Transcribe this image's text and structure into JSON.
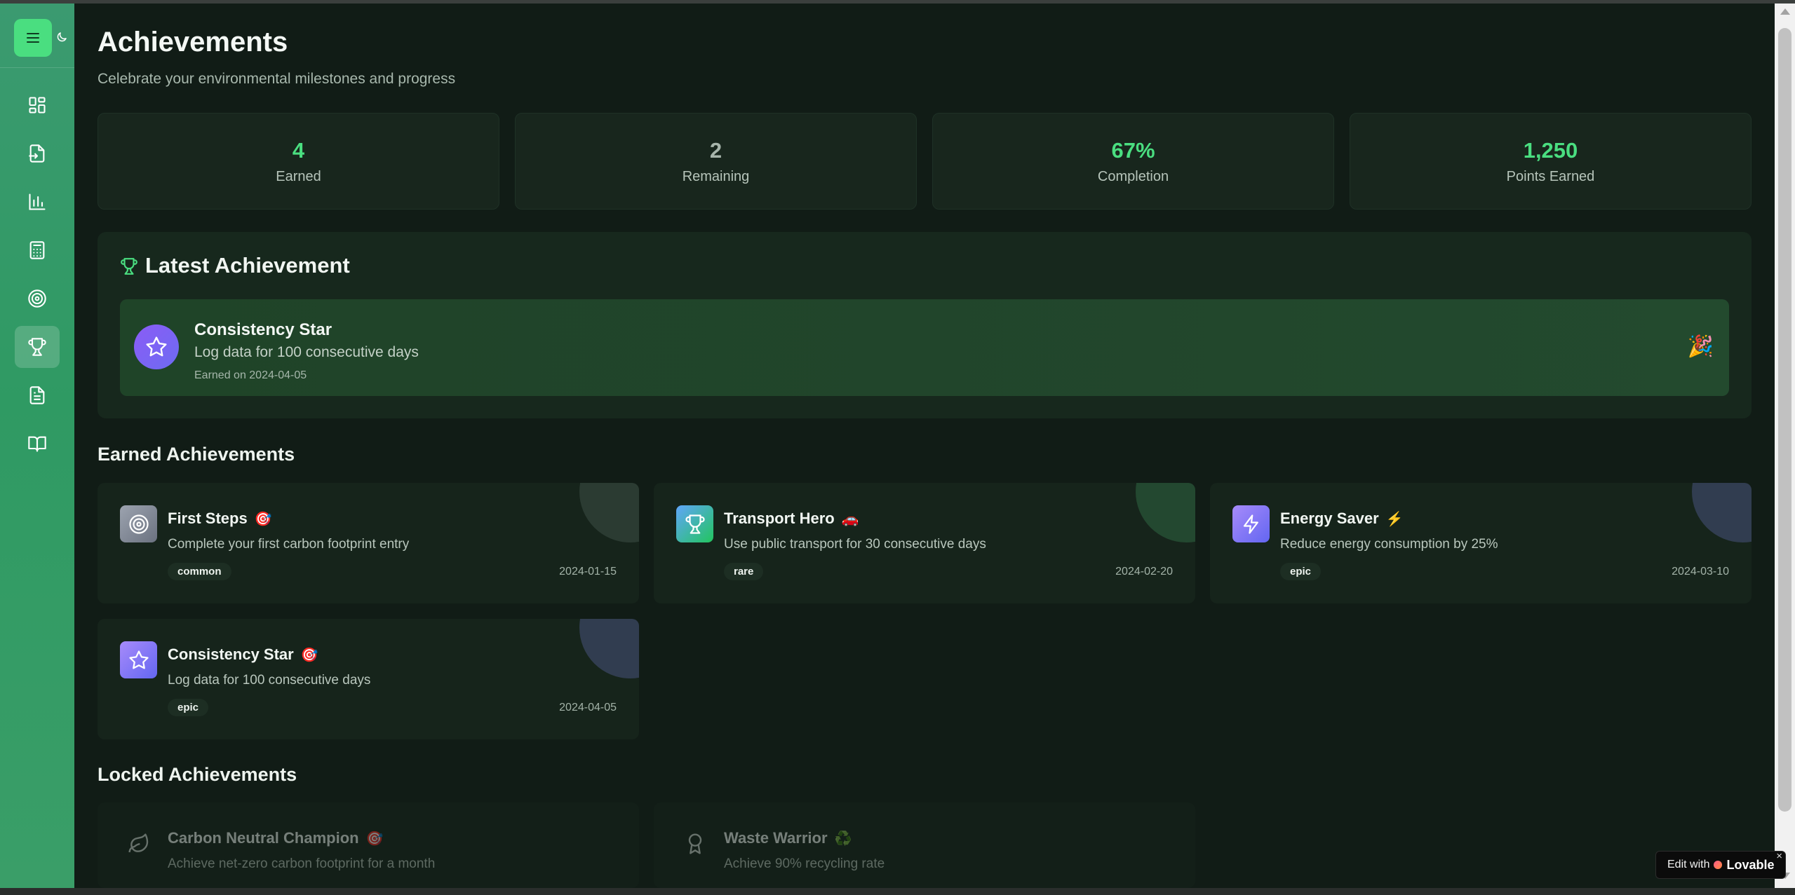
{
  "page": {
    "title": "Achievements",
    "subtitle": "Celebrate your environmental milestones and progress"
  },
  "stats": [
    {
      "value": "4",
      "label": "Earned",
      "color": "#4ade80"
    },
    {
      "value": "2",
      "label": "Remaining",
      "color": "#a7b5ab"
    },
    {
      "value": "67%",
      "label": "Completion",
      "color": "#4ade80"
    },
    {
      "value": "1,250",
      "label": "Points Earned",
      "color": "#4ade80"
    }
  ],
  "latest": {
    "heading": "Latest Achievement",
    "name": "Consistency Star",
    "description": "Log data for 100 consecutive days",
    "earned": "Earned on 2024-04-05",
    "emoji": "🎉"
  },
  "earned_section": {
    "title": "Earned Achievements",
    "items": [
      {
        "name": "First Steps",
        "emoji": "🎯",
        "description": "Complete your first carbon footprint entry",
        "tag": "common",
        "date": "2024-01-15",
        "icon": "target-icon"
      },
      {
        "name": "Transport Hero",
        "emoji": "🚗",
        "description": "Use public transport for 30 consecutive days",
        "tag": "rare",
        "date": "2024-02-20",
        "icon": "trophy-icon"
      },
      {
        "name": "Energy Saver",
        "emoji": "⚡",
        "description": "Reduce energy consumption by 25%",
        "tag": "epic",
        "date": "2024-03-10",
        "icon": "lightning-icon"
      },
      {
        "name": "Consistency Star",
        "emoji": "🎯",
        "description": "Log data for 100 consecutive days",
        "tag": "epic",
        "date": "2024-04-05",
        "icon": "star-icon"
      }
    ]
  },
  "locked_section": {
    "title": "Locked Achievements",
    "items": [
      {
        "name": "Carbon Neutral Champion",
        "emoji": "🎯",
        "description": "Achieve net-zero carbon footprint for a month",
        "icon": "leaf-icon"
      },
      {
        "name": "Waste Warrior",
        "emoji": "♻️",
        "description": "Achieve 90% recycling rate",
        "icon": "award-icon"
      }
    ]
  },
  "sidebar": {
    "items": [
      {
        "icon": "dashboard-icon",
        "active": false
      },
      {
        "icon": "data-entry-icon",
        "active": false
      },
      {
        "icon": "analytics-icon",
        "active": false
      },
      {
        "icon": "calculator-icon",
        "active": false
      },
      {
        "icon": "goals-icon",
        "active": false
      },
      {
        "icon": "achievements-icon",
        "active": true
      },
      {
        "icon": "reports-icon",
        "active": false
      },
      {
        "icon": "learn-icon",
        "active": false
      }
    ]
  },
  "badge": {
    "text": "Edit with",
    "brand": "Lovable",
    "close": "×"
  }
}
